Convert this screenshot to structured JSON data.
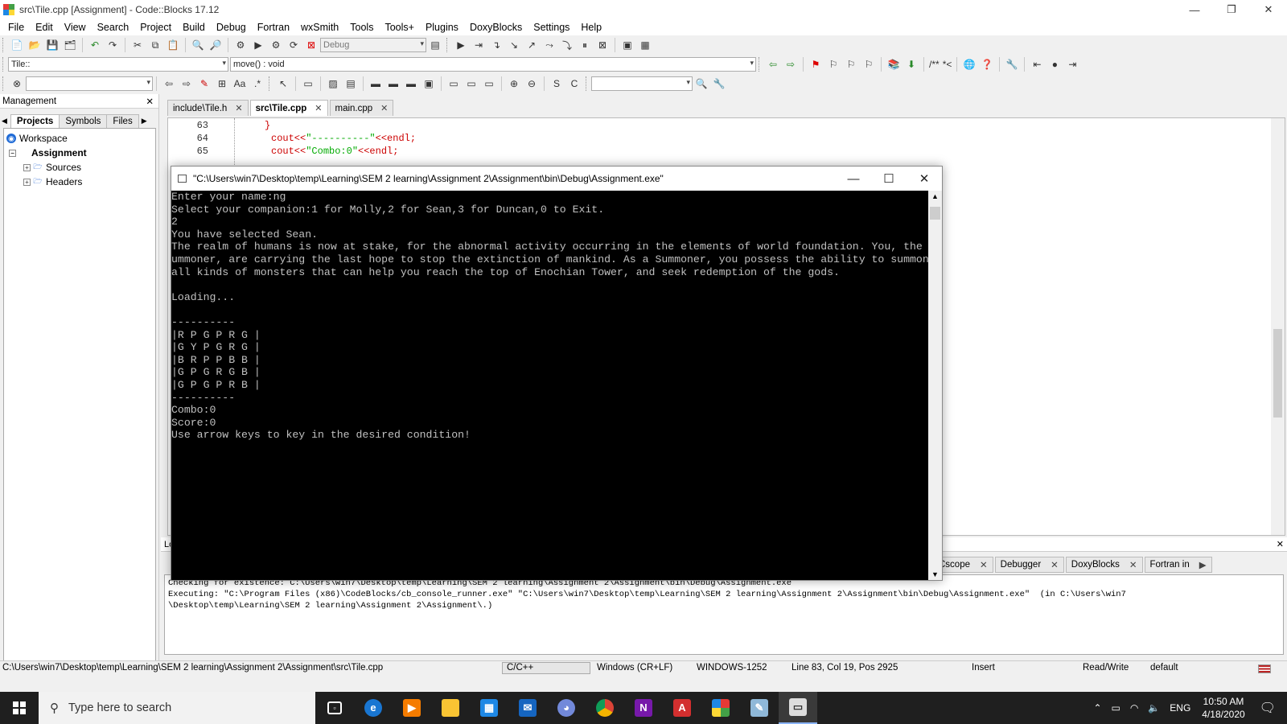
{
  "window": {
    "title": "src\\Tile.cpp [Assignment] - Code::Blocks 17.12",
    "minimize": "—",
    "maximize": "❐",
    "close": "✕"
  },
  "menu": [
    "File",
    "Edit",
    "View",
    "Search",
    "Project",
    "Build",
    "Debug",
    "Fortran",
    "wxSmith",
    "Tools",
    "Tools+",
    "Plugins",
    "DoxyBlocks",
    "Settings",
    "Help"
  ],
  "toolbar": {
    "build_target": "Debug",
    "scope": "Tile::",
    "function": "move() : void",
    "comment_block": "/**",
    "comment_line": "*<"
  },
  "management": {
    "title": "Management",
    "close": "✕",
    "tabs": [
      "Projects",
      "Symbols",
      "Files"
    ],
    "tree": {
      "workspace": "Workspace",
      "project": "Assignment",
      "sources": "Sources",
      "headers": "Headers"
    }
  },
  "editor": {
    "tabs": [
      {
        "label": "include\\Tile.h",
        "close": "✕"
      },
      {
        "label": "src\\Tile.cpp",
        "close": "✕"
      },
      {
        "label": "main.cpp",
        "close": "✕"
      }
    ],
    "lines": [
      {
        "num": "63",
        "brace": "}"
      },
      {
        "num": "64",
        "kw": "cout<<",
        "str": "\"----------\"",
        "kw2": "<<endl;"
      },
      {
        "num": "65",
        "kw": "cout<<",
        "str": "\"Combo:0\"",
        "kw2": "<<endl;"
      }
    ]
  },
  "console": {
    "title": "\"C:\\Users\\win7\\Desktop\\temp\\Learning\\SEM 2 learning\\Assignment 2\\Assignment\\bin\\Debug\\Assignment.exe\"",
    "output": "Enter your name:ng\nSelect your companion:1 for Molly,2 for Sean,3 for Duncan,0 to Exit.\n2\nYou have selected Sean.\nThe realm of humans is now at stake, for the abnormal activity occurring in the elements of world foundation. You, the S\nummoner, are carrying the last hope to stop the extinction of mankind. As a Summoner, you possess the ability to summon\nall kinds of monsters that can help you reach the top of Enochian Tower, and seek redemption of the gods.\n\nLoading...\n\n----------\n|R P G P R G |\n|G Y P G R G |\n|B R P P B B |\n|G P G R G B |\n|G P G P R B |\n----------\nCombo:0\nScore:0\nUse arrow keys to key in the desired condition!"
  },
  "logs": {
    "title": "Lo",
    "close": "✕",
    "tabs": [
      {
        "label": "Cscope",
        "close": "✕"
      },
      {
        "label": "Debugger",
        "close": "✕"
      },
      {
        "label": "DoxyBlocks",
        "close": "✕"
      },
      {
        "label": "Fortran in",
        "close": "▶"
      }
    ],
    "text": "Checking for existence: C:\\Users\\win7\\Desktop\\temp\\Learning\\SEM 2 learning\\Assignment 2\\Assignment\\bin\\Debug\\Assignment.exe\nExecuting: \"C:\\Program Files (x86)\\CodeBlocks/cb_console_runner.exe\" \"C:\\Users\\win7\\Desktop\\temp\\Learning\\SEM 2 learning\\Assignment 2\\Assignment\\bin\\Debug\\Assignment.exe\"  (in C:\\Users\\win7\n\\Desktop\\temp\\Learning\\SEM 2 learning\\Assignment 2\\Assignment\\.)"
  },
  "status": {
    "path": "C:\\Users\\win7\\Desktop\\temp\\Learning\\SEM 2 learning\\Assignment 2\\Assignment\\src\\Tile.cpp",
    "lang": "C/C++",
    "eol": "Windows (CR+LF)",
    "encoding": "WINDOWS-1252",
    "position": "Line 83, Col 19, Pos 2925",
    "mode": "Insert",
    "access": "Read/Write",
    "profile": "default"
  },
  "taskbar": {
    "search_placeholder": "Type here to search",
    "language": "ENG",
    "time": "10:50 AM",
    "date": "4/18/2020"
  }
}
